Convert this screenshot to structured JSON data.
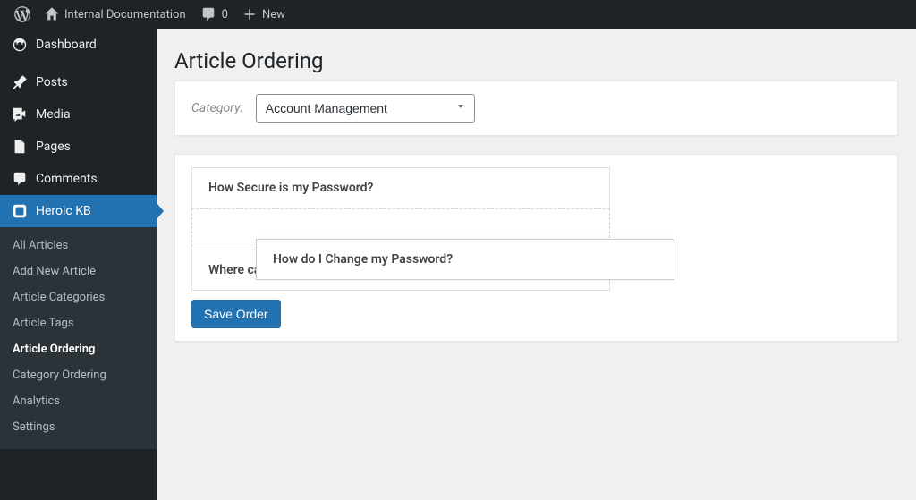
{
  "adminbar": {
    "site_name": "Internal Documentation",
    "comments_count": "0",
    "new_label": "New"
  },
  "sidebar": {
    "items": [
      {
        "key": "dashboard",
        "label": "Dashboard",
        "icon": "dashboard"
      },
      {
        "key": "posts",
        "label": "Posts",
        "icon": "pin"
      },
      {
        "key": "media",
        "label": "Media",
        "icon": "media"
      },
      {
        "key": "pages",
        "label": "Pages",
        "icon": "page"
      },
      {
        "key": "comments",
        "label": "Comments",
        "icon": "comment"
      },
      {
        "key": "heroic-kb",
        "label": "Heroic KB",
        "icon": "kb",
        "active": true
      }
    ],
    "submenu": [
      {
        "key": "all-articles",
        "label": "All Articles"
      },
      {
        "key": "add-new",
        "label": "Add New Article"
      },
      {
        "key": "categories",
        "label": "Article Categories"
      },
      {
        "key": "tags",
        "label": "Article Tags"
      },
      {
        "key": "ordering",
        "label": "Article Ordering",
        "active": true
      },
      {
        "key": "cat-ordering",
        "label": "Category Ordering"
      },
      {
        "key": "analytics",
        "label": "Analytics"
      },
      {
        "key": "settings",
        "label": "Settings"
      }
    ]
  },
  "page": {
    "title": "Article Ordering",
    "category_label": "Category:",
    "category_selected": "Account Management",
    "save_label": "Save Order"
  },
  "articles": [
    {
      "title": "How Secure is my Password?"
    },
    {
      "title": "How do I Change my Password?",
      "dragging": true
    },
    {
      "title": "Where can I Upload my Avatar?"
    }
  ]
}
